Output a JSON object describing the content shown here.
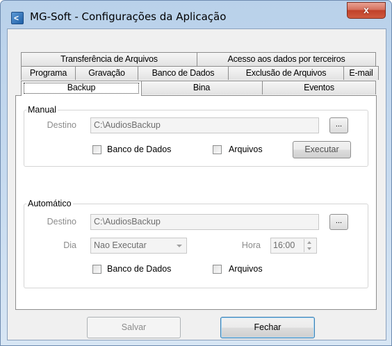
{
  "window": {
    "title": "MG-Soft - Configurações da Aplicação",
    "close_glyph": "x",
    "app_icon_glyph": "<"
  },
  "tabs": {
    "row1": [
      "Transferência de Arquivos",
      "Acesso aos dados por terceiros"
    ],
    "row2": [
      "Programa",
      "Gravação",
      "Banco de Dados",
      "Exclusão de Arquivos",
      "E-mail"
    ],
    "row3": [
      "Backup",
      "Bina",
      "Eventos"
    ],
    "active": "Backup"
  },
  "manual": {
    "legend": "Manual",
    "destino_label": "Destino",
    "destino_value": "C:\\AudiosBackup",
    "browse_label": "...",
    "banco_label": "Banco de Dados",
    "banco_checked": false,
    "arquivos_label": "Arquivos",
    "arquivos_checked": false,
    "executar_label": "Executar"
  },
  "automatico": {
    "legend": "Automático",
    "destino_label": "Destino",
    "destino_value": "C:\\AudiosBackup",
    "browse_label": "...",
    "dia_label": "Dia",
    "dia_value": "Nao Executar",
    "hora_label": "Hora",
    "hora_value": "16:00",
    "banco_label": "Banco de Dados",
    "banco_checked": false,
    "arquivos_label": "Arquivos",
    "arquivos_checked": false
  },
  "footer": {
    "salvar_label": "Salvar",
    "fechar_label": "Fechar"
  },
  "icons": {
    "dropdown": "chevron-down-icon",
    "spinner": "spinner-icon",
    "close": "close-icon",
    "app": "app-icon"
  }
}
